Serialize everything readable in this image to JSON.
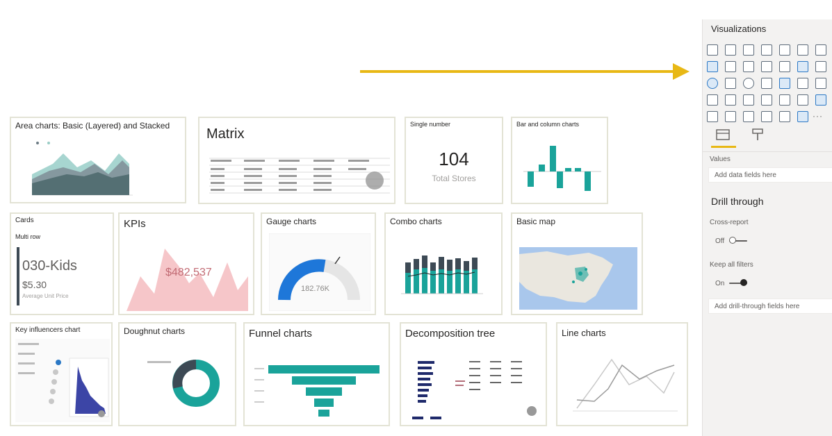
{
  "tiles": {
    "area": {
      "title": "Area charts: Basic (Layered) and Stacked"
    },
    "matrix": {
      "title": "Matrix"
    },
    "single": {
      "title": "Single number",
      "value": "104",
      "caption": "Total Stores"
    },
    "bar": {
      "title": "Bar and column charts"
    },
    "cards": {
      "title": "Cards",
      "subtitle": "Multi row",
      "value1": "030-Kids",
      "value2": "$5.30",
      "caption": "Average Unit Price"
    },
    "kpis": {
      "title": "KPIs",
      "value": "$482,537"
    },
    "gauge": {
      "title": "Gauge charts",
      "value": "182.76K"
    },
    "combo": {
      "title": "Combo charts"
    },
    "map": {
      "title": "Basic map"
    },
    "keyinf": {
      "title": "Key influencers chart"
    },
    "donut": {
      "title": "Doughnut charts"
    },
    "funnel": {
      "title": "Funnel charts"
    },
    "decomp": {
      "title": "Decomposition tree"
    },
    "line": {
      "title": "Line charts"
    }
  },
  "pane": {
    "title": "Visualizations",
    "values_label": "Values",
    "values_placeholder": "Add data fields here",
    "drill_title": "Drill through",
    "cross_report_label": "Cross-report",
    "cross_report_state": "Off",
    "keep_filters_label": "Keep all filters",
    "keep_filters_state": "On",
    "drill_placeholder": "Add drill-through fields here",
    "more_icon": "···"
  },
  "colors": {
    "teal": "#1aa39a",
    "dark": "#3d4a55",
    "navy": "#1f2a6b",
    "pink": "#f5bcc0",
    "blue": "#1e77d9",
    "arrow": "#e8b815"
  }
}
